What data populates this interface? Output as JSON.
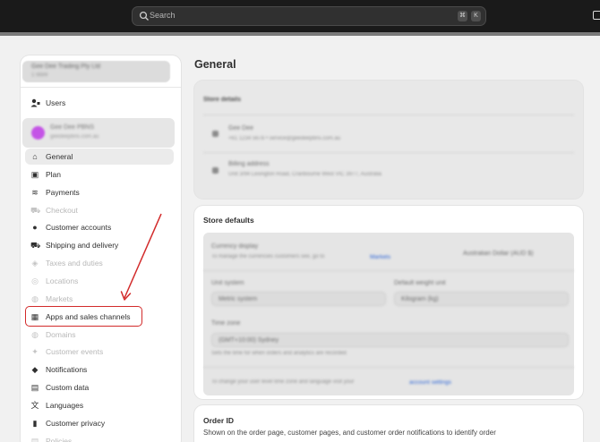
{
  "topbar": {
    "search_placeholder": "Search",
    "shortcut_modifier": "⌘",
    "shortcut_key": "K"
  },
  "sidebar": {
    "organization": {
      "name": "Gee Dee Trading Pty Ltd",
      "subtitle": "1 store"
    },
    "users_label": "Users",
    "store": {
      "name": "Gee Dee PBNS",
      "url": "geedeepbns.com.au"
    },
    "items": [
      {
        "label": "General",
        "icon": "store-icon",
        "glyph": "⌂",
        "active": true,
        "disabled": false
      },
      {
        "label": "Plan",
        "icon": "plan-icon",
        "glyph": "▣",
        "active": false,
        "disabled": false
      },
      {
        "label": "Payments",
        "icon": "payments-icon",
        "glyph": "≋",
        "active": false,
        "disabled": false
      },
      {
        "label": "Checkout",
        "icon": "cart-icon",
        "glyph": "⛟",
        "active": false,
        "disabled": true
      },
      {
        "label": "Customer accounts",
        "icon": "person-icon",
        "glyph": "●",
        "active": false,
        "disabled": false
      },
      {
        "label": "Shipping and delivery",
        "icon": "truck-icon",
        "glyph": "⛟",
        "active": false,
        "disabled": false
      },
      {
        "label": "Taxes and duties",
        "icon": "tax-icon",
        "glyph": "◈",
        "active": false,
        "disabled": true
      },
      {
        "label": "Locations",
        "icon": "location-icon",
        "glyph": "◎",
        "active": false,
        "disabled": true
      },
      {
        "label": "Markets",
        "icon": "globe-icon",
        "glyph": "◍",
        "active": false,
        "disabled": true
      },
      {
        "label": "Apps and sales channels",
        "icon": "apps-icon",
        "glyph": "▦",
        "active": false,
        "disabled": false
      },
      {
        "label": "Domains",
        "icon": "globe-icon",
        "glyph": "◍",
        "active": false,
        "disabled": true
      },
      {
        "label": "Customer events",
        "icon": "events-icon",
        "glyph": "✦",
        "active": false,
        "disabled": true
      },
      {
        "label": "Notifications",
        "icon": "bell-icon",
        "glyph": "◆",
        "active": false,
        "disabled": false
      },
      {
        "label": "Custom data",
        "icon": "database-icon",
        "glyph": "▤",
        "active": false,
        "disabled": false
      },
      {
        "label": "Languages",
        "icon": "languages-icon",
        "glyph": "文",
        "active": false,
        "disabled": false
      },
      {
        "label": "Customer privacy",
        "icon": "lock-icon",
        "glyph": "▮",
        "active": false,
        "disabled": false
      },
      {
        "label": "Policies",
        "icon": "policy-icon",
        "glyph": "▤",
        "active": false,
        "disabled": true
      }
    ]
  },
  "main": {
    "title": "General",
    "store_details": {
      "heading": "Store details",
      "owner_name": "Gee Dee",
      "owner_contact": "+61 1234 5678 • service@geedeepbns.com.au",
      "billing_label": "Billing address",
      "billing_value": "Unit 3/94 Lexington Road, Cranbourne West VIC 3977, Australia"
    },
    "store_defaults": {
      "title": "Store defaults",
      "currency_label": "Currency display",
      "currency_desc": "To manage the currencies customers see, go to",
      "currency_link": "Markets",
      "currency_value": "Australian Dollar (AUD $)",
      "unit_label": "Unit system",
      "unit_value": "Metric system",
      "weight_label": "Default weight unit",
      "weight_value": "Kilogram (kg)",
      "timezone_label": "Time zone",
      "timezone_value": "(GMT+10:00) Sydney",
      "timezone_note": "Sets the time for when orders and analytics are recorded",
      "footer_text": "To change your user level time zone and language visit your",
      "footer_link": "account settings"
    },
    "order_id": {
      "title": "Order ID",
      "description": "Shown on the order page, customer pages, and customer order notifications to identify order"
    }
  }
}
